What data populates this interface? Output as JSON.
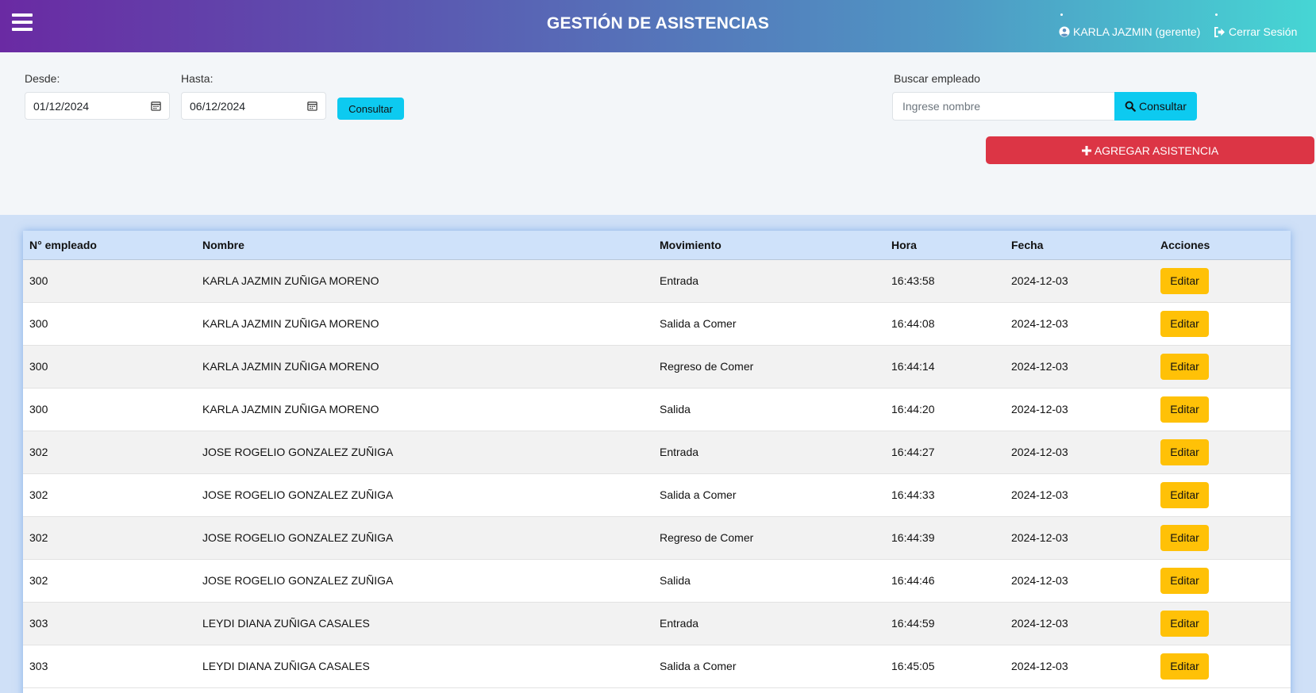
{
  "header": {
    "title": "GESTIÓN DE ASISTENCIAS",
    "user_label": "KARLA JAZMIN (gerente)",
    "logout_label": "Cerrar Sesión"
  },
  "filters": {
    "desde_label": "Desde:",
    "desde_value": "01/12/2024",
    "hasta_label": "Hasta:",
    "hasta_value": "06/12/2024",
    "consultar_label": "Consultar",
    "buscar_label": "Buscar empleado",
    "buscar_placeholder": "Ingrese nombre",
    "buscar_button": "Consultar",
    "add_button": "AGREGAR ASISTENCIA"
  },
  "table": {
    "columns": [
      "N° empleado",
      "Nombre",
      "Movimiento",
      "Hora",
      "Fecha",
      "Acciones"
    ],
    "edit_label": "Editar",
    "rows": [
      {
        "id": "300",
        "nombre": "KARLA JAZMIN ZUÑIGA MORENO",
        "movimiento": "Entrada",
        "hora": "16:43:58",
        "fecha": "2024-12-03"
      },
      {
        "id": "300",
        "nombre": "KARLA JAZMIN ZUÑIGA MORENO",
        "movimiento": "Salida a Comer",
        "hora": "16:44:08",
        "fecha": "2024-12-03"
      },
      {
        "id": "300",
        "nombre": "KARLA JAZMIN ZUÑIGA MORENO",
        "movimiento": "Regreso de Comer",
        "hora": "16:44:14",
        "fecha": "2024-12-03"
      },
      {
        "id": "300",
        "nombre": "KARLA JAZMIN ZUÑIGA MORENO",
        "movimiento": "Salida",
        "hora": "16:44:20",
        "fecha": "2024-12-03"
      },
      {
        "id": "302",
        "nombre": "JOSE ROGELIO GONZALEZ ZUÑIGA",
        "movimiento": "Entrada",
        "hora": "16:44:27",
        "fecha": "2024-12-03"
      },
      {
        "id": "302",
        "nombre": "JOSE ROGELIO GONZALEZ ZUÑIGA",
        "movimiento": "Salida a Comer",
        "hora": "16:44:33",
        "fecha": "2024-12-03"
      },
      {
        "id": "302",
        "nombre": "JOSE ROGELIO GONZALEZ ZUÑIGA",
        "movimiento": "Regreso de Comer",
        "hora": "16:44:39",
        "fecha": "2024-12-03"
      },
      {
        "id": "302",
        "nombre": "JOSE ROGELIO GONZALEZ ZUÑIGA",
        "movimiento": "Salida",
        "hora": "16:44:46",
        "fecha": "2024-12-03"
      },
      {
        "id": "303",
        "nombre": "LEYDI DIANA ZUÑIGA CASALES",
        "movimiento": "Entrada",
        "hora": "16:44:59",
        "fecha": "2024-12-03"
      },
      {
        "id": "303",
        "nombre": "LEYDI DIANA ZUÑIGA CASALES",
        "movimiento": "Salida a Comer",
        "hora": "16:45:05",
        "fecha": "2024-12-03"
      }
    ]
  },
  "colors": {
    "gradient_start": "#6a2aa3",
    "gradient_end": "#46d6d4",
    "info_button": "#0dcaf0",
    "danger_button": "#dc3545",
    "warning_button": "#ffc107"
  }
}
